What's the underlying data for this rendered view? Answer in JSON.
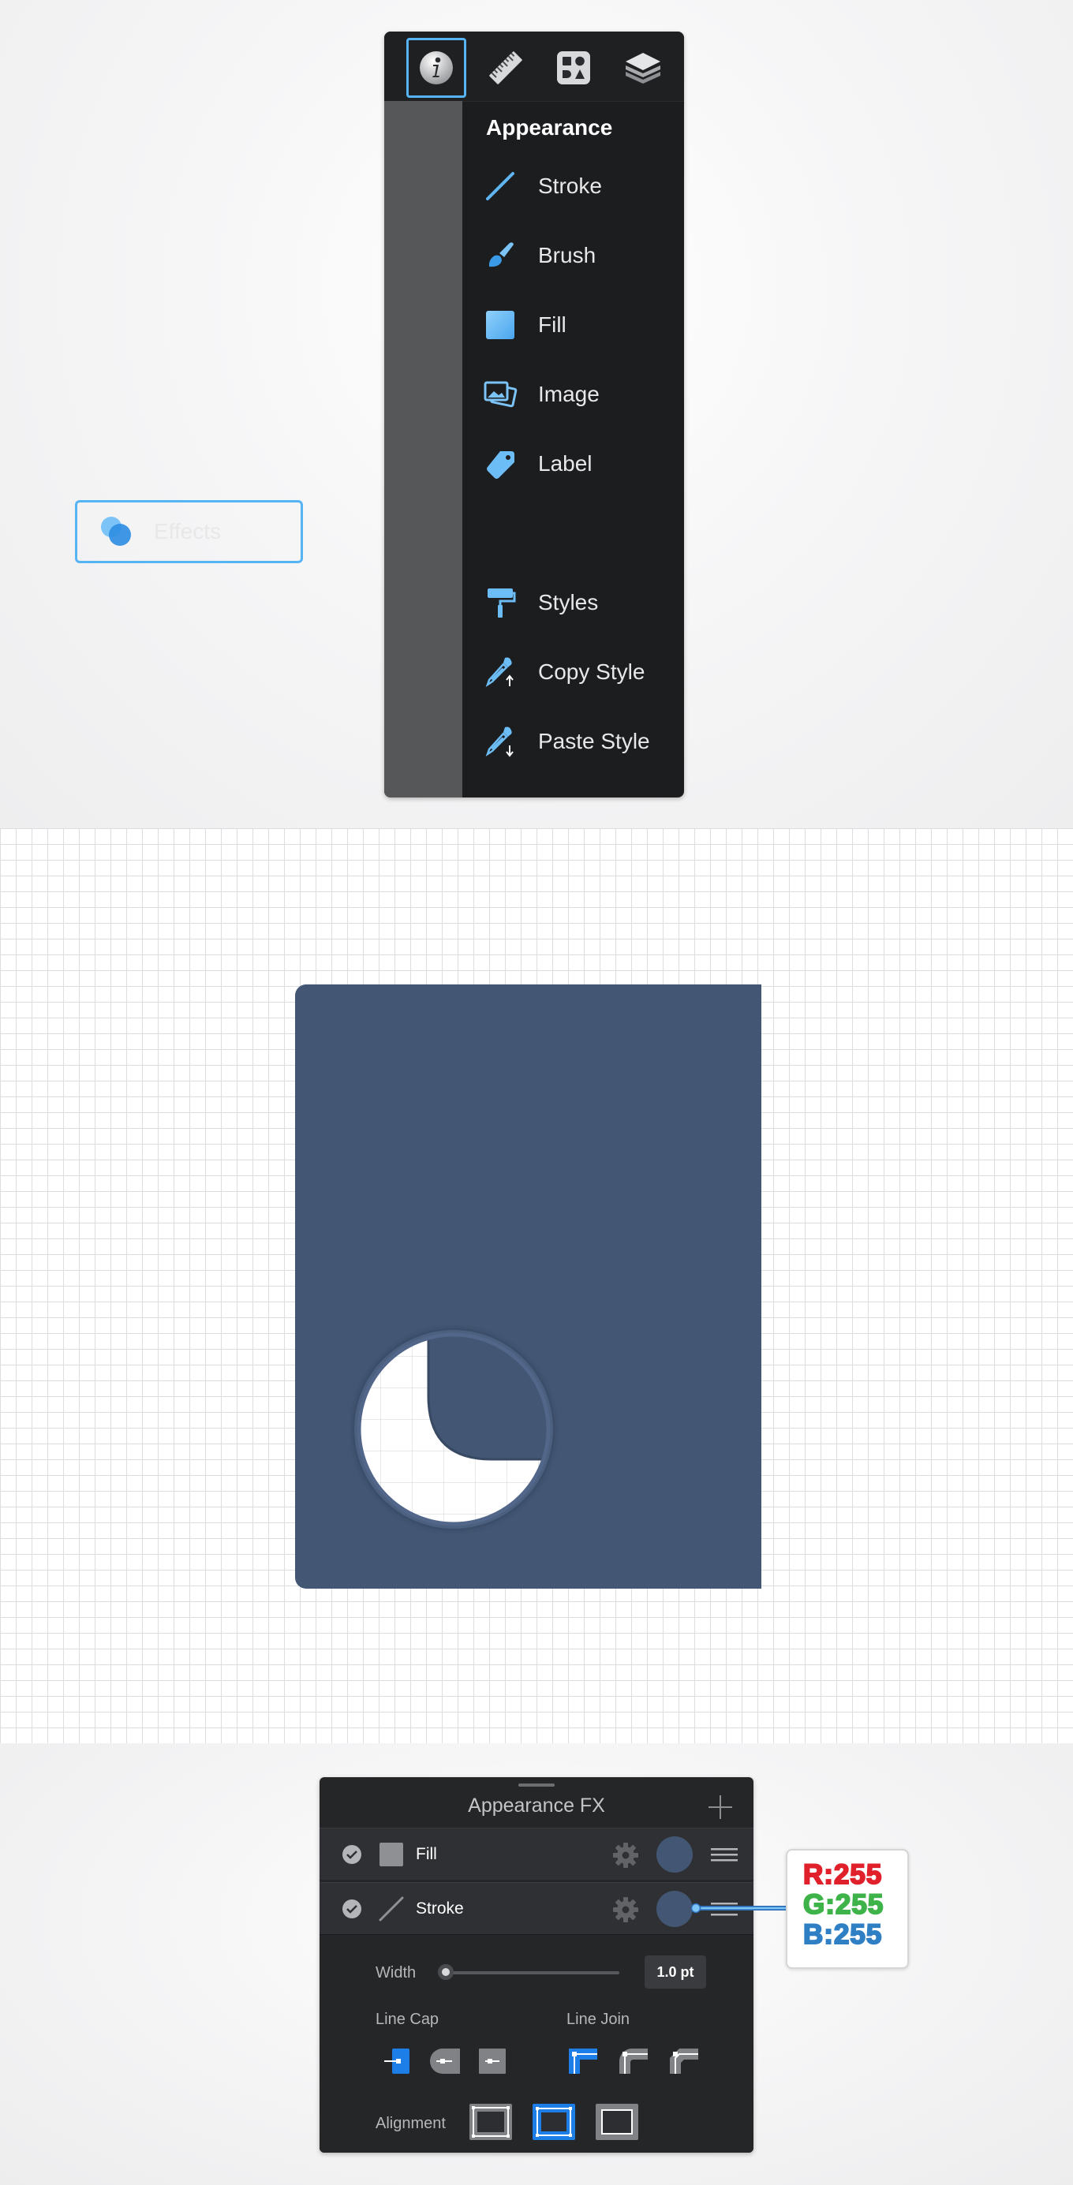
{
  "toolbar": {
    "icons": [
      "info-icon",
      "ruler-icon",
      "shapes-icon",
      "layers-icon"
    ],
    "active": "info-icon"
  },
  "appearance_menu": {
    "title": "Appearance",
    "items": [
      {
        "label": "Stroke",
        "icon": "stroke-icon"
      },
      {
        "label": "Brush",
        "icon": "brush-icon"
      },
      {
        "label": "Fill",
        "icon": "fill-icon"
      },
      {
        "label": "Image",
        "icon": "image-icon"
      },
      {
        "label": "Label",
        "icon": "label-icon"
      },
      {
        "label": "Effects",
        "icon": "effects-icon"
      },
      {
        "label": "Styles",
        "icon": "styles-icon"
      },
      {
        "label": "Copy Style",
        "icon": "copy-style-icon"
      },
      {
        "label": "Paste Style",
        "icon": "paste-style-icon"
      }
    ],
    "selected": "Effects"
  },
  "canvas": {
    "shape_color": "#435673",
    "magnifier_fill": "#ffffff"
  },
  "fx_panel": {
    "title": "Appearance FX",
    "rows": [
      {
        "label": "Fill",
        "enabled": true,
        "color": "#435673"
      },
      {
        "label": "Stroke",
        "enabled": true,
        "color": "#435673"
      }
    ],
    "width_label": "Width",
    "width_value": "1.0 pt",
    "width_slider_fraction": 0.0,
    "line_cap_label": "Line Cap",
    "line_join_label": "Line Join",
    "alignment_label": "Alignment",
    "selected_line_cap": "butt",
    "selected_line_join": "miter",
    "selected_alignment": "center"
  },
  "rgb_tooltip": {
    "r": "R:",
    "r_value": "255",
    "g": "G:",
    "g_value": "255",
    "b": "B:",
    "b_value": "255",
    "colors": {
      "r": "#e0202a",
      "g": "#3eb34a",
      "b": "#2f7fc4"
    }
  },
  "accent_color": "#56b4f5"
}
